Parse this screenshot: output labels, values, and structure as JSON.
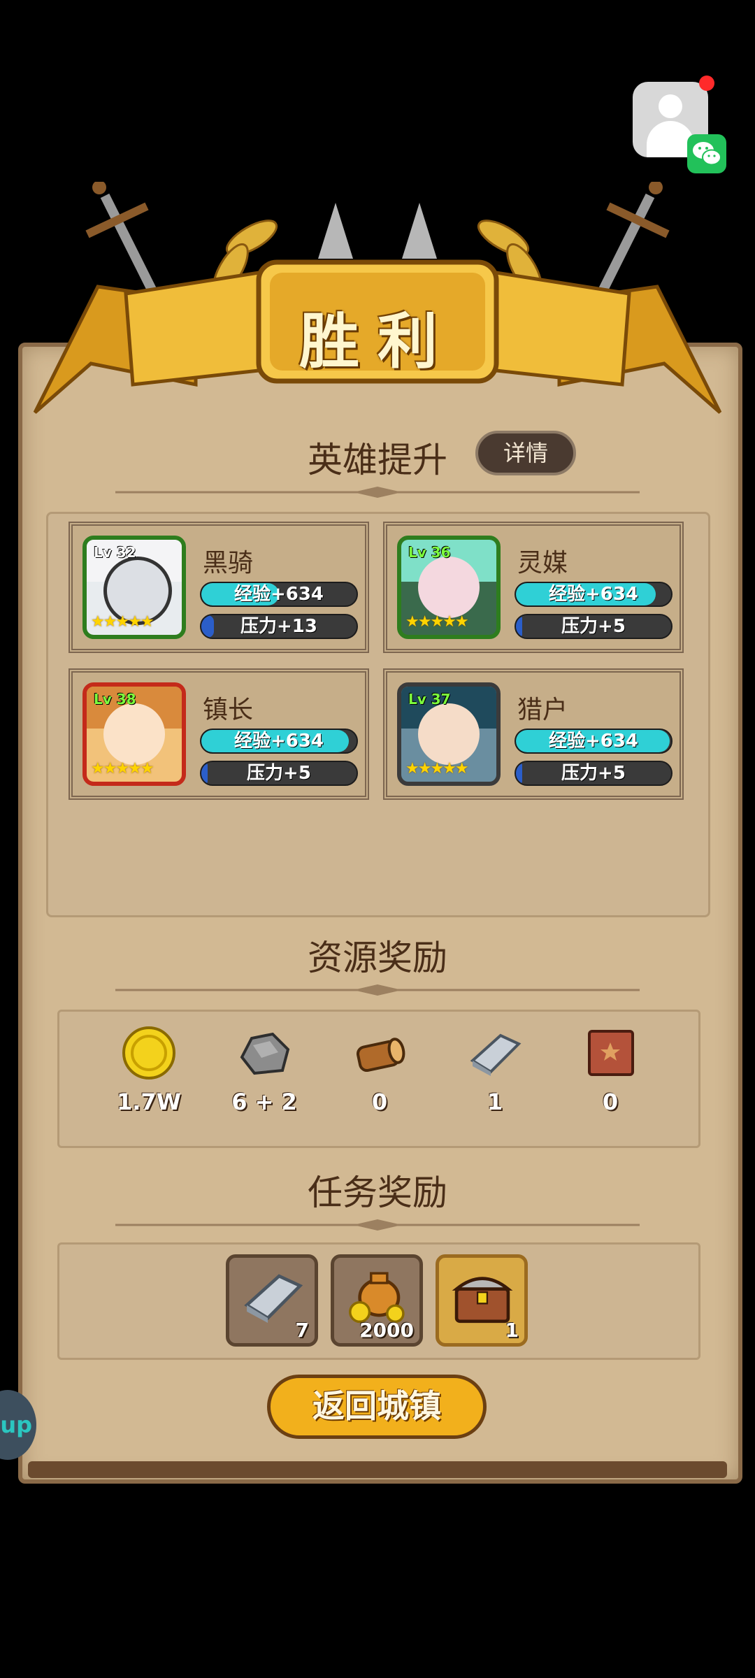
{
  "victory": {
    "title": "胜利"
  },
  "heroes_section": {
    "title": "英雄提升",
    "details_label": "详情",
    "heroes": [
      {
        "name": "黑骑",
        "level": "Lv 32",
        "exp": "经验+634",
        "exp_fill": 0.5,
        "pressure": "压力+13",
        "pressure_fill": 0.08,
        "stars": "★★★★★"
      },
      {
        "name": "灵媒",
        "level": "Lv 36",
        "exp": "经验+634",
        "exp_fill": 0.9,
        "pressure": "压力+5",
        "pressure_fill": 0.04,
        "stars": "★★★★★"
      },
      {
        "name": "镇长",
        "level": "Lv 38",
        "exp": "经验+634",
        "exp_fill": 0.95,
        "pressure": "压力+5",
        "pressure_fill": 0.04,
        "stars": "★★★★★"
      },
      {
        "name": "猎户",
        "level": "Lv 37",
        "exp": "经验+634",
        "exp_fill": 0.99,
        "pressure": "压力+5",
        "pressure_fill": 0.04,
        "stars": "★★★★★"
      }
    ]
  },
  "resources_section": {
    "title": "资源奖励",
    "items": [
      {
        "icon": "gold-coin-icon",
        "value": "1.7W"
      },
      {
        "icon": "stone-icon",
        "value": "6 + 2"
      },
      {
        "icon": "wood-log-icon",
        "value": "0"
      },
      {
        "icon": "iron-ingot-icon",
        "value": "1"
      },
      {
        "icon": "leather-icon",
        "value": "0"
      }
    ]
  },
  "tasks_section": {
    "title": "任务奖励",
    "items": [
      {
        "icon": "iron-ingot-icon",
        "count": "7"
      },
      {
        "icon": "gold-bag-icon",
        "count": "2000"
      },
      {
        "icon": "treasure-chest-icon",
        "count": "1"
      }
    ]
  },
  "return_button": "返回城镇",
  "side_tab": "up",
  "colors": {
    "exp_bar": "#2fd0d6",
    "pressure_bar": "#2b5ec9",
    "button_gold": "#f2b01c",
    "panel": "#d2b993"
  }
}
